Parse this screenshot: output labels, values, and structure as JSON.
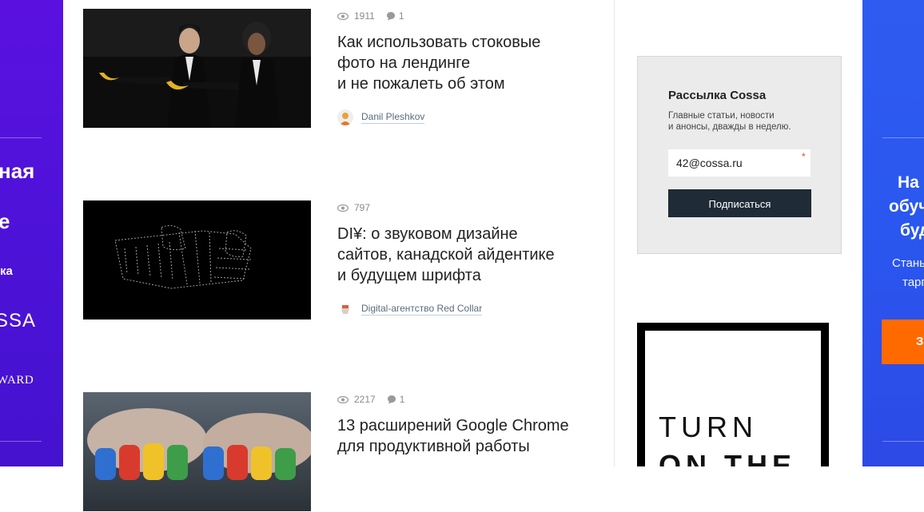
{
  "left_rail": {
    "heading_1": "ная",
    "heading_2": "е",
    "subtext": "ка",
    "logo": "SSA",
    "award": "WARD"
  },
  "right_rail": {
    "heading_1": "На",
    "heading_2": "обуч",
    "heading_3": "буд",
    "sub_1": "Стань",
    "sub_2": "тарг",
    "cta": "З"
  },
  "articles": [
    {
      "views": "1911",
      "comments": "1",
      "title_lines": [
        "Как использовать стоковые",
        "фото на лендинге",
        "и не пожалеть об этом"
      ],
      "author": "Danil Pleshkov"
    },
    {
      "views": "797",
      "comments": "",
      "title_lines": [
        "DI¥: о звуковом дизайне",
        "сайтов, канадской айдентике",
        "и будущем шрифта"
      ],
      "author": "Digital-агентство Red Collar"
    },
    {
      "views": "2217",
      "comments": "1",
      "title_lines": [
        "13 расширений Google Chrome",
        "для продуктивной работы"
      ],
      "author": ""
    }
  ],
  "newsletter": {
    "title": "Рассылка Cossa",
    "desc_1": "Главные статьи, новости",
    "desc_2": "и анонсы, дважды в неделю.",
    "email_value": "42@cossa.ru",
    "required_mark": "*",
    "button": "Подписаться"
  },
  "banner": {
    "line_1": "TURN",
    "line_2": "ON THE"
  },
  "colors": {
    "left_rail": "#5a11e0",
    "right_rail": "#2f5bf0",
    "cta": "#ff6a00",
    "button": "#1f2b36"
  }
}
